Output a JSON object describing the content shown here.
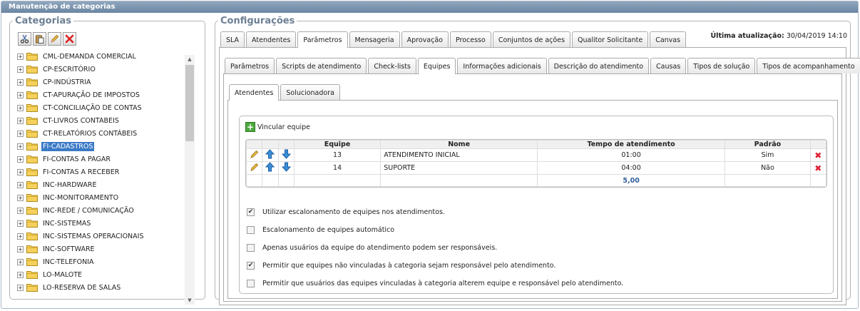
{
  "window": {
    "title": "Manutenção de categorias"
  },
  "categories": {
    "legend": "Categorias",
    "toolbar": [
      {
        "icon": "cut-icon"
      },
      {
        "icon": "paste-icon"
      },
      {
        "icon": "edit-icon"
      },
      {
        "icon": "delete-icon"
      }
    ],
    "items": [
      "CML-DEMANDA COMERCIAL",
      "CP-ESCRITÓRIO",
      "CP-INDÚSTRIA",
      "CT-APURAÇÃO DE IMPOSTOS",
      "CT-CONCILIAÇÃO DE CONTAS",
      "CT-LIVROS CONTABEIS",
      "CT-RELATÓRIOS CONTÁBEIS",
      "FI-CADASTROS",
      "FI-CONTAS A PAGAR",
      "FI-CONTAS A RECEBER",
      "INC-HARDWARE",
      "INC-MONITORAMENTO",
      "INC-REDE / COMUNICAÇÃO",
      "INC-SISTEMAS",
      "INC-SISTEMAS OPERACIONAIS",
      "INC-SOFTWARE",
      "INC-TELEFONIA",
      "LO-MALOTE",
      "LO-RESERVA DE SALAS"
    ],
    "selected": "FI-CADASTROS"
  },
  "config": {
    "legend": "Configurações",
    "last_update_label": "Última atualização:",
    "last_update_value": "30/04/2019 14:10",
    "tabs1": [
      "SLA",
      "Atendentes",
      "Parâmetros",
      "Mensageria",
      "Aprovação",
      "Processo",
      "Conjuntos de ações",
      "Qualitor Solicitante",
      "Canvas"
    ],
    "tabs1_active": "Parâmetros",
    "tabs2": [
      "Parâmetros",
      "Scripts de atendimento",
      "Check-lists",
      "Equipes",
      "Informações adicionais",
      "Descrição do atendimento",
      "Causas",
      "Tipos de solução",
      "Tipos de acompanhamento"
    ],
    "tabs2_active": "Equipes",
    "tabs3": [
      "Atendentes",
      "Solucionadora"
    ],
    "tabs3_active": "Atendentes",
    "link_team": "Vincular equipe",
    "table": {
      "headers": [
        "Equipe",
        "Nome",
        "Tempo de atendimento",
        "Padrão"
      ],
      "rows": [
        {
          "equipe": "13",
          "nome": "ATENDIMENTO INICIAL",
          "tempo": "01:00",
          "padrao": "Sim"
        },
        {
          "equipe": "14",
          "nome": "SUPORTE",
          "tempo": "04:00",
          "padrao": "Não"
        }
      ],
      "total": "5,00"
    },
    "options": [
      {
        "label": "Utilizar escalonamento de equipes nos atendimentos.",
        "checked": true
      },
      {
        "label": "Escalonamento de equipes automático",
        "checked": false
      },
      {
        "label": "Apenas usuários da equipe do atendimento podem ser responsáveis.",
        "checked": false
      },
      {
        "label": "Permitir que equipes não vinculadas à categoria sejam responsável pelo atendimento.",
        "checked": true
      },
      {
        "label": "Permitir que usuários das equipes vinculadas à categoria alterem equipe e responsável pelo atendimento.",
        "checked": false
      }
    ]
  }
}
